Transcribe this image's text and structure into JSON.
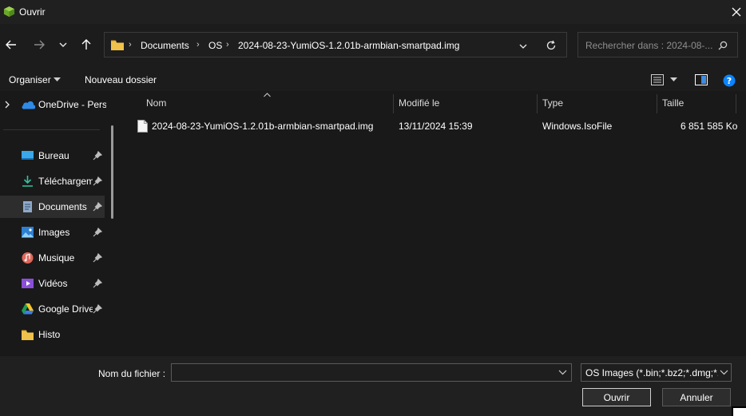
{
  "window": {
    "title": "Ouvrir"
  },
  "nav": {
    "breadcrumb": [
      "Documents",
      "OS",
      "2024-08-23-YumiOS-1.2.01b-armbian-smartpad.img"
    ],
    "search_placeholder": "Rechercher dans : 2024-08-..."
  },
  "commands": {
    "organize": "Organiser",
    "new_folder": "Nouveau dossier"
  },
  "sidebar": {
    "top_item": {
      "label": "OneDrive - Perso",
      "icon": "onedrive-icon"
    },
    "items": [
      {
        "label": "Bureau",
        "icon": "desktop-icon",
        "pinned": true
      },
      {
        "label": "Téléchargements",
        "icon": "download-icon",
        "pinned": true
      },
      {
        "label": "Documents",
        "icon": "documents-icon",
        "pinned": true,
        "active": true
      },
      {
        "label": "Images",
        "icon": "pictures-icon",
        "pinned": true
      },
      {
        "label": "Musique",
        "icon": "music-icon",
        "pinned": true
      },
      {
        "label": "Vidéos",
        "icon": "videos-icon",
        "pinned": true
      },
      {
        "label": "Google Drive",
        "icon": "google-drive-icon",
        "pinned": true
      },
      {
        "label": "Histo",
        "icon": "folder-icon",
        "pinned": false
      }
    ]
  },
  "table": {
    "columns": [
      "Nom",
      "Modifié le",
      "Type",
      "Taille"
    ],
    "rows": [
      {
        "name": "2024-08-23-YumiOS-1.2.01b-armbian-smartpad.img",
        "modified": "13/11/2024 15:39",
        "type": "Windows.IsoFile",
        "size": "6 851 585 Ko"
      }
    ]
  },
  "footer": {
    "filename_label": "Nom du fichier :",
    "filename_value": "",
    "filter": "OS Images (*.bin;*.bz2;*.dmg;*.",
    "open": "Ouvrir",
    "cancel": "Annuler"
  },
  "colors": {
    "accent": "#0a84ff",
    "folder": "#f0c24b"
  }
}
